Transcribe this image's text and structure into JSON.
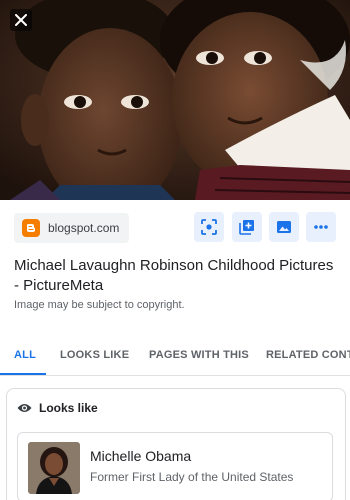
{
  "image": {
    "description_icon": "child-portrait-photo"
  },
  "source": {
    "domain": "blogspot.com",
    "icon": "blogger-icon"
  },
  "actions": [
    {
      "name": "lens-search-button",
      "icon": "lens-icon"
    },
    {
      "name": "add-to-collection-button",
      "icon": "add-collection-icon"
    },
    {
      "name": "view-image-button",
      "icon": "image-icon"
    },
    {
      "name": "more-options-button",
      "icon": "more-dots-icon"
    }
  ],
  "result": {
    "title": "Michael Lavaughn Robinson Childhood Pictures - PictureMeta",
    "copyright_note": "Image may be subject to copyright."
  },
  "tabs": [
    {
      "label": "ALL",
      "active": true
    },
    {
      "label": "LOOKS LIKE",
      "active": false
    },
    {
      "label": "PAGES WITH THIS",
      "active": false
    },
    {
      "label": "RELATED CONTENT",
      "active": false
    }
  ],
  "looks_like": {
    "heading": "Looks like",
    "entity": {
      "name": "Michelle Obama",
      "description": "Former First Lady of the United States"
    }
  },
  "colors": {
    "accent": "#1a73e8",
    "chip_bg": "#e8f0fe",
    "blogger": "#f57d00"
  }
}
